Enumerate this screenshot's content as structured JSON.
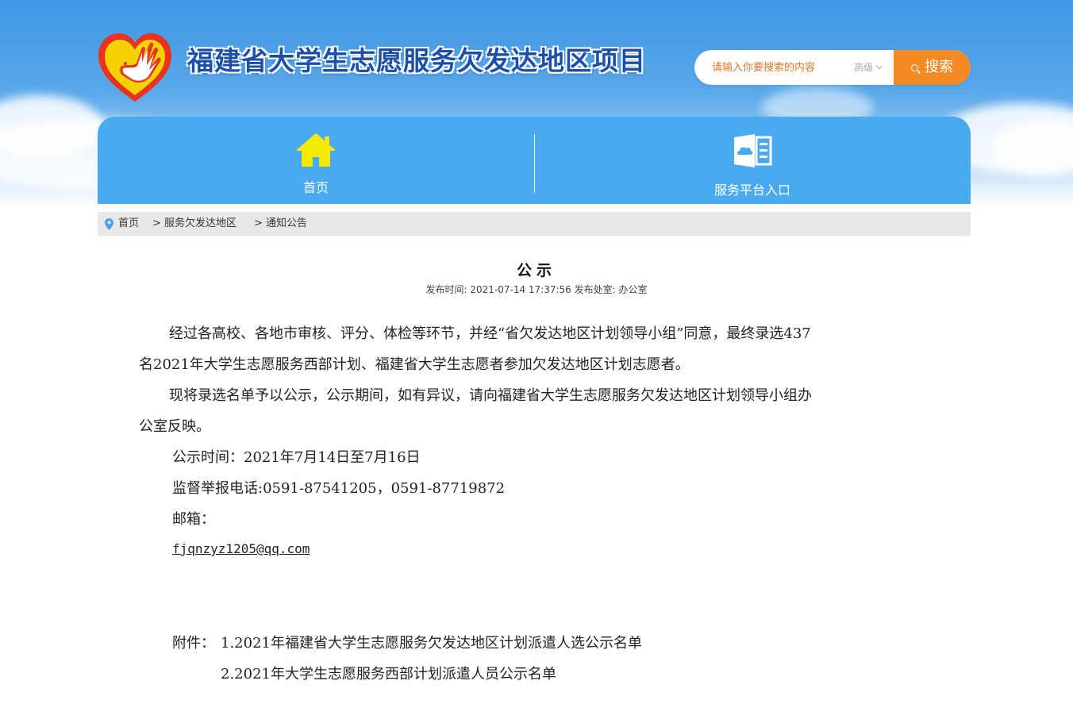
{
  "header": {
    "site_title": "福建省大学生志愿服务欠发达地区项目",
    "logo_icon": "heart-hand-dove-logo-icon"
  },
  "search": {
    "placeholder": "请输入你要搜索的内容",
    "advanced_label": "高级",
    "button_label": "搜索"
  },
  "nav": {
    "items": [
      {
        "label": "首页",
        "icon": "home-icon"
      },
      {
        "label": "服务平台入口",
        "icon": "cloud-document-icon"
      }
    ]
  },
  "breadcrumb": {
    "items": [
      "首页",
      "> 服务欠发达地区",
      "> 通知公告"
    ]
  },
  "article": {
    "title": "公示",
    "meta": "发布时间:  2021-07-14 17:37:56 发布处室:  办公室",
    "para1_line1": "经过各高校、各地市审核、评分、体检等环节，并经“省欠发达地区计划领导小组”同意，最终录选437",
    "para1_line2": "名2021年大学生志愿服务西部计划、福建省大学生志愿者参加欠发达地区计划志愿者。",
    "para2_line1": "现将录选名单予以公示，公示期间，如有异议，请向福建省大学生志愿服务欠发达地区计划领导小组办",
    "para2_line2": "公室反映。",
    "period": "公示时间：2021年7月14日至7月16日",
    "phone": "监督举报电话:0591-87541205，0591-87719872",
    "email_label": "邮箱：",
    "email": "fjqnzyz1205@qq.com",
    "attachments_label": "附件：",
    "attachment_1": "1.2021年福建省大学生志愿服务欠发达地区计划派遣人选公示名单",
    "attachment_2": "2.2021年大学生志愿服务西部计划派遣人员公示名单"
  },
  "colors": {
    "nav_bg": "#4aaaf0",
    "search_button": "#f38a24",
    "title_blue": "#1b4fa8",
    "home_icon": "#f5e900",
    "breadcrumb_bg": "#e9e8e8"
  }
}
